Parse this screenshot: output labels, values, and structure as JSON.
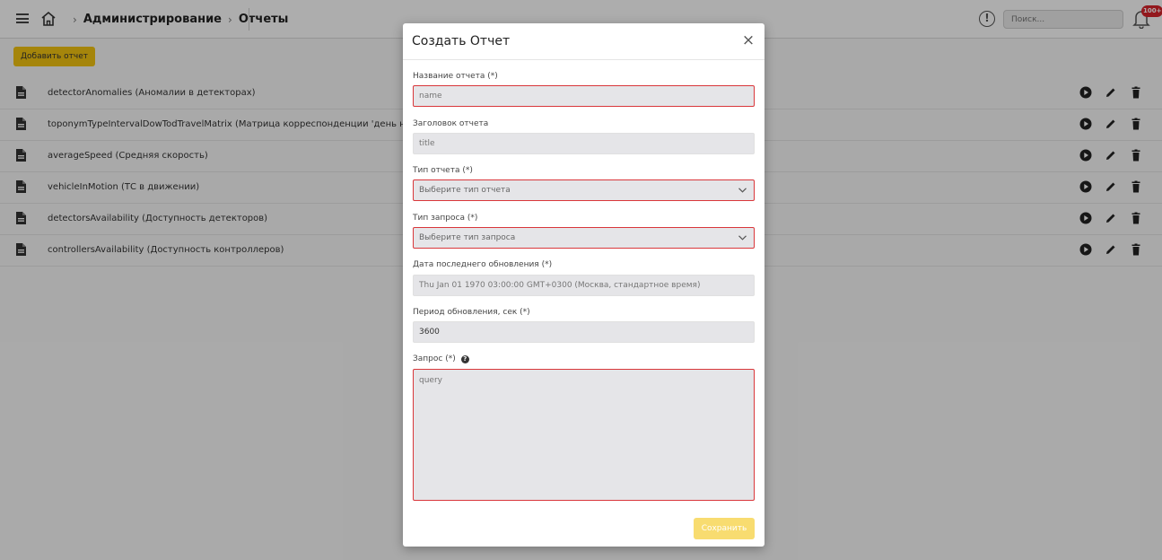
{
  "header": {
    "breadcrumb": [
      "Администрирование",
      "Отчеты"
    ],
    "search_placeholder": "Поиск...",
    "notifications_badge": "100+"
  },
  "toolbar": {
    "add_label": "Добавить отчет"
  },
  "reports": [
    "detectorAnomalies (Аномалии в детекторах)",
    "toponymTypeIntervalDowTodTravelMatrix (Матрица корреспонденции 'день недели/время",
    "averageSpeed (Средняя скорость)",
    "vehicleInMotion (ТС в движении)",
    "detectorsAvailability (Доступность детекторов)",
    "controllersAvailability (Доступность контроллеров)"
  ],
  "modal": {
    "title": "Создать Отчет",
    "close_symbol": "×",
    "name_label": "Название отчета (*)",
    "name_placeholder": "name",
    "title_label": "Заголовок отчета",
    "title_placeholder": "title",
    "type_label": "Тип отчета (*)",
    "type_value": "Выберите тип отчета",
    "query_type_label": "Тип запроса (*)",
    "query_type_value": "Выберите тип запроса",
    "last_update_label": "Дата последнего обновления (*)",
    "last_update_value": "Thu Jan 01 1970 03:00:00 GMT+0300 (Москва, стандартное время)",
    "period_label": "Период обновления, сек (*)",
    "period_value": "3600",
    "query_label": "Запрос (*)",
    "query_placeholder": "query",
    "save_label": "Сохранить"
  },
  "colors": {
    "accent": "#f4c511",
    "error": "#d9373b",
    "badge": "#d9242b"
  },
  "icons": [
    "menu-icon",
    "home-icon",
    "alert-icon",
    "bell-icon",
    "file-icon",
    "play-icon",
    "edit-icon",
    "delete-icon",
    "chevron-down-icon",
    "help-icon"
  ]
}
